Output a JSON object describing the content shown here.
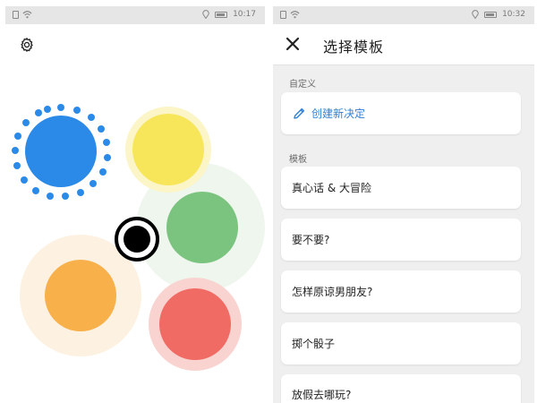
{
  "left_screen": {
    "status_bar": {
      "time": "10:17"
    },
    "settings_icon": "gear-icon",
    "circles": {
      "blue": {
        "color": "#2b8ae8",
        "state": "selected"
      },
      "yellow": {
        "color": "#f7e65a"
      },
      "green": {
        "color": "#7bc47f"
      },
      "orange": {
        "color": "#f7b04a"
      },
      "red": {
        "color": "#f06b63"
      },
      "center": {
        "color": "#000000"
      }
    }
  },
  "right_screen": {
    "status_bar": {
      "time": "10:32"
    },
    "header": {
      "title": "选择模板",
      "close_icon": "close-icon"
    },
    "custom_section": {
      "label": "自定义",
      "create_button": {
        "label": "创建新决定",
        "icon": "pencil-icon"
      }
    },
    "templates_section": {
      "label": "模板",
      "items": [
        {
          "label": "真心话 & 大冒险"
        },
        {
          "label": "要不要?"
        },
        {
          "label": "怎样原谅男朋友?"
        },
        {
          "label": "掷个骰子"
        },
        {
          "label": "放假去哪玩?"
        }
      ]
    }
  }
}
